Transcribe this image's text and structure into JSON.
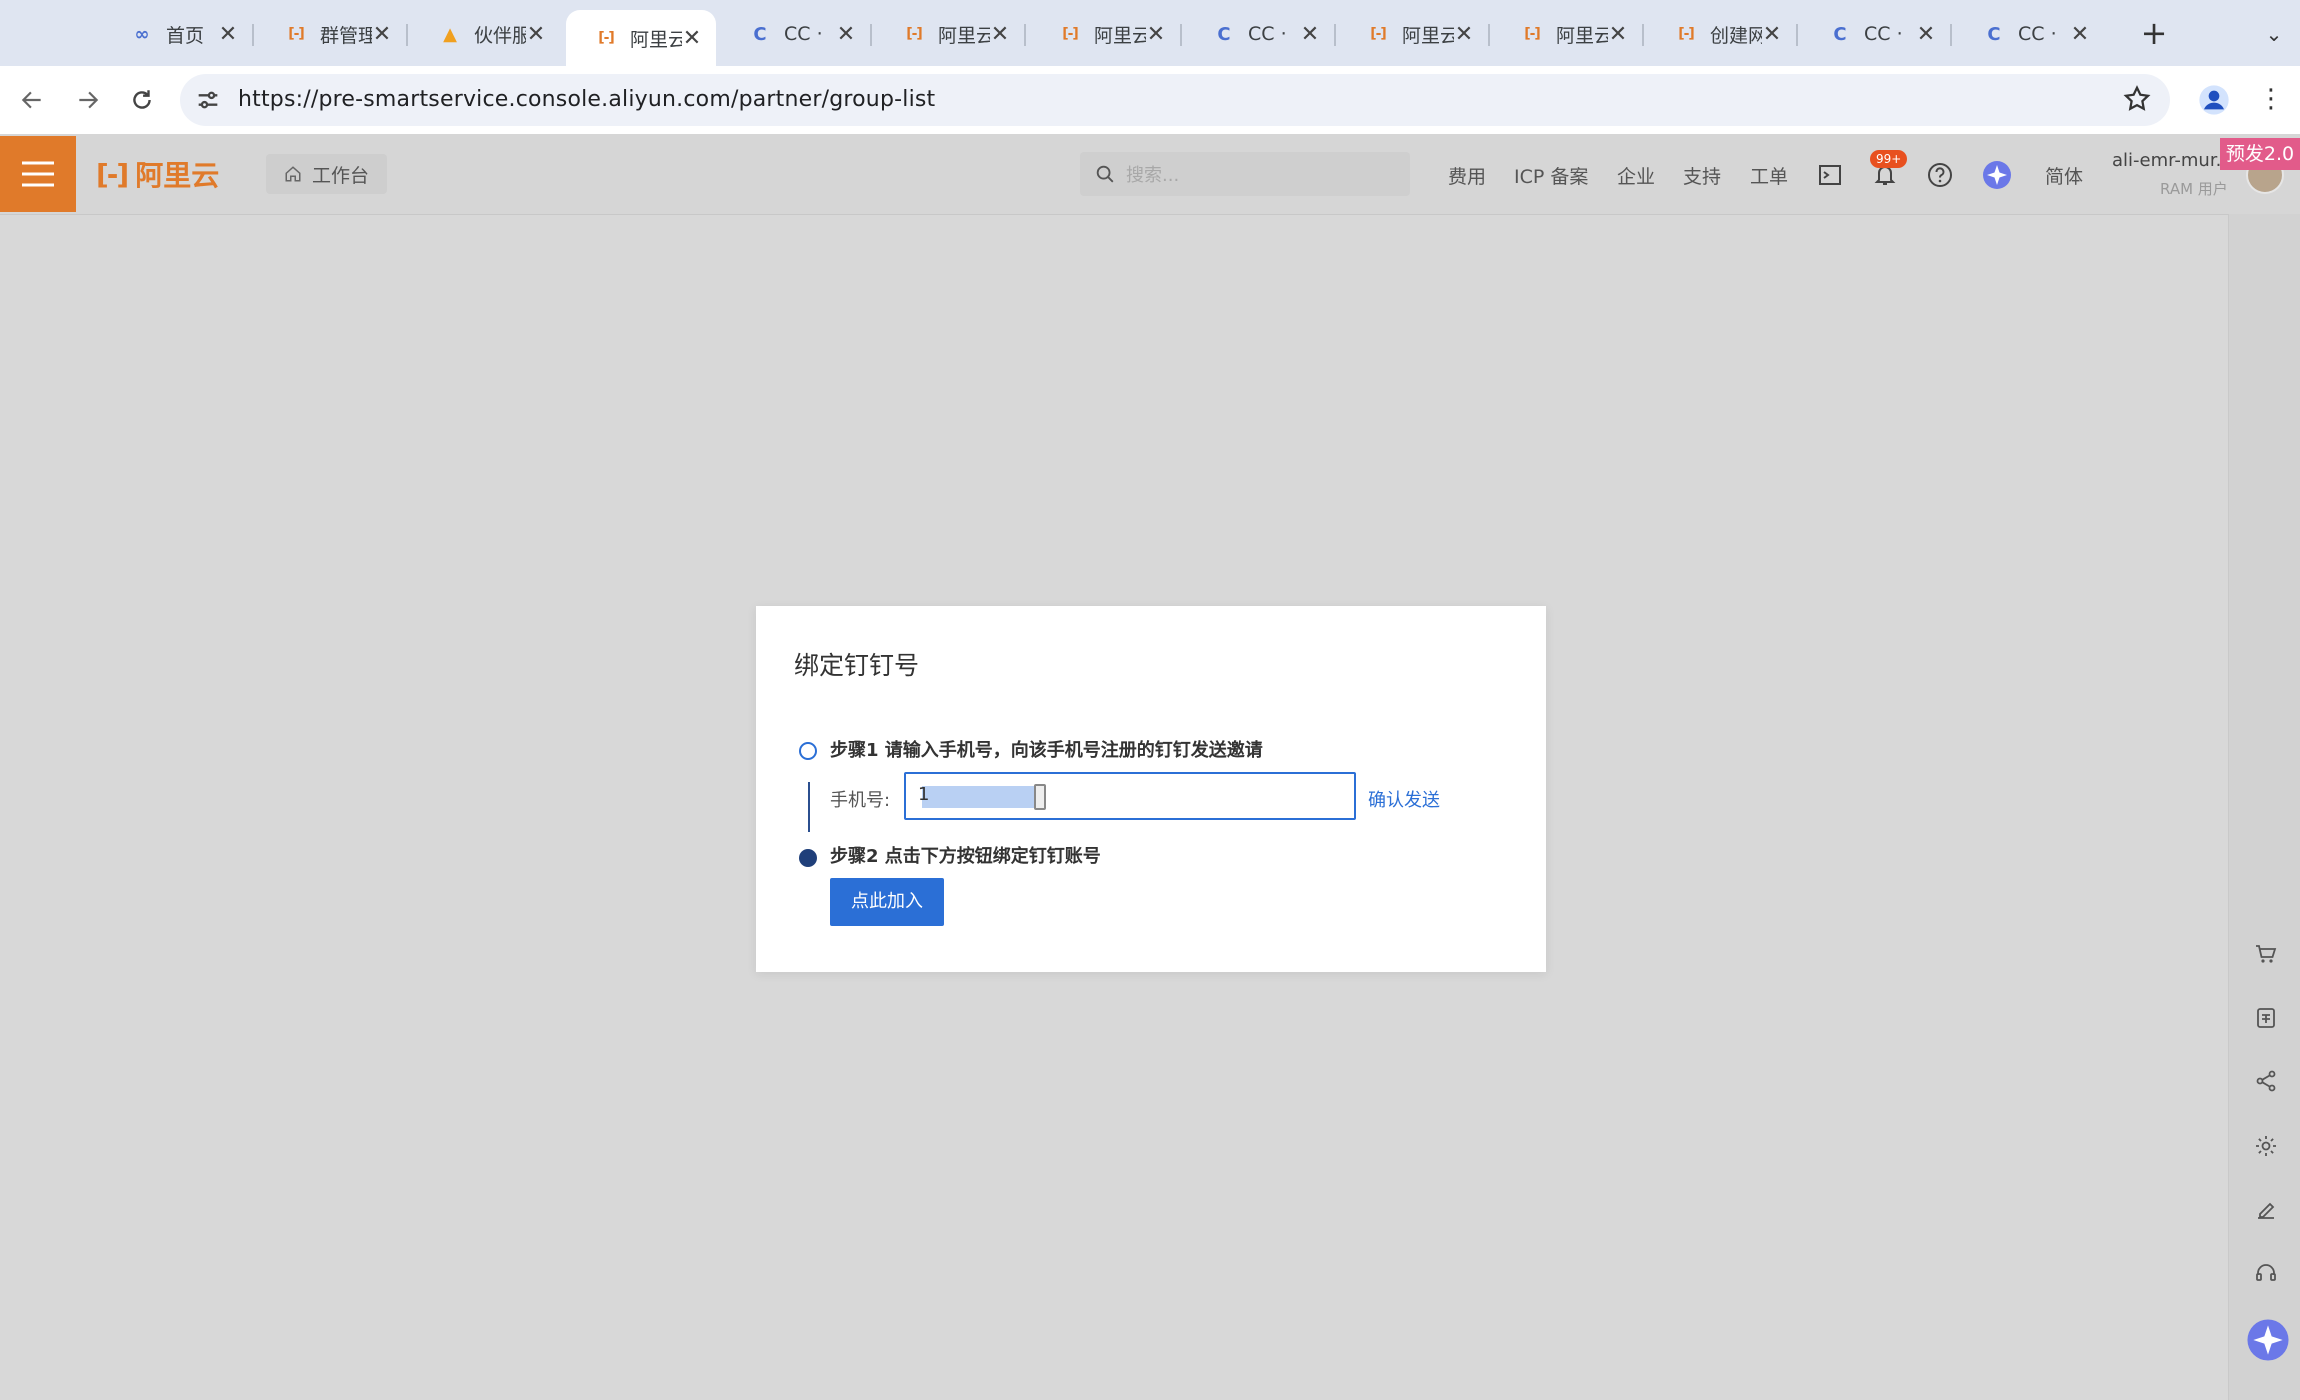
{
  "browser": {
    "tabs": [
      {
        "title": "首页",
        "favicon": "infinity-icon",
        "color": "#4a6fd0"
      },
      {
        "title": "群管理",
        "favicon": "aliyun-icon",
        "color": "#e07a2a"
      },
      {
        "title": "伙伴服",
        "favicon": "flame-icon",
        "color": "#f0a020"
      },
      {
        "title": "阿里云",
        "favicon": "aliyun-icon",
        "color": "#e07a2a",
        "active": true
      },
      {
        "title": "CC ·",
        "favicon": "cc-icon",
        "color": "#4a6fd0"
      },
      {
        "title": "阿里云",
        "favicon": "aliyun-icon",
        "color": "#e07a2a"
      },
      {
        "title": "阿里云",
        "favicon": "aliyun-icon",
        "color": "#e07a2a"
      },
      {
        "title": "CC ·",
        "favicon": "cc-icon",
        "color": "#4a6fd0"
      },
      {
        "title": "阿里云",
        "favicon": "aliyun-icon",
        "color": "#e07a2a"
      },
      {
        "title": "阿里云",
        "favicon": "aliyun-icon",
        "color": "#e07a2a"
      },
      {
        "title": "创建网",
        "favicon": "aliyun-icon",
        "color": "#e07a2a"
      },
      {
        "title": "CC ·",
        "favicon": "cc-icon",
        "color": "#4a6fd0"
      },
      {
        "title": "CC ·",
        "favicon": "cc-icon",
        "color": "#4a6fd0"
      }
    ],
    "url": "https://pre-smartservice.console.aliyun.com/partner/group-list"
  },
  "header": {
    "logo": "阿里云",
    "workbench": "工作台",
    "search_placeholder": "搜索...",
    "nav": [
      "费用",
      "ICP 备案",
      "企业",
      "支持",
      "工单"
    ],
    "notification_badge": "99+",
    "language": "简体",
    "user_name": "ali-emr-mur...",
    "user_role": "RAM 用户",
    "pre_release_badge": "预发2.0",
    "brand_color": "#e07a2a"
  },
  "dialog": {
    "title": "绑定钉钉号",
    "step1": "步骤1 请输入手机号，向该手机号注册的钉钉发送邀请",
    "phone_label": "手机号:",
    "phone_value": "1",
    "confirm_send": "确认发送",
    "step2": "步骤2 点击下方按钮绑定钉钉账号",
    "join_button": "点此加入"
  }
}
